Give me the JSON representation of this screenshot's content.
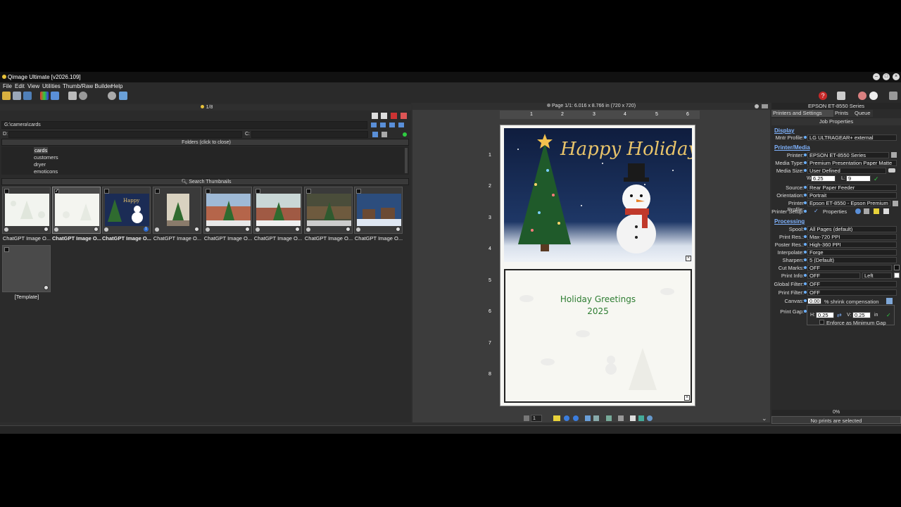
{
  "window": {
    "title": "Qimage Ultimate [v2026.109]"
  },
  "menu": [
    "File",
    "Edit",
    "View",
    "Utilities",
    "Thumb/Raw Builder",
    "Help"
  ],
  "left": {
    "page_indicator": "1/8",
    "path": "G:\\camera\\cards",
    "d_label": "D:",
    "c_label": "C:",
    "folders_header": "Folders (click to close)",
    "folders": [
      "cards",
      "customers",
      "dryer",
      "emoticons"
    ],
    "search_thumbnails": "Search Thumbnails",
    "thumbs": [
      {
        "label": "ChatGPT Image O...",
        "checked": false,
        "bold": false
      },
      {
        "label": "ChatGPT Image O...",
        "checked": true,
        "bold": true
      },
      {
        "label": "ChatGPT Image O...",
        "checked": false,
        "bold": true,
        "badge": "1"
      },
      {
        "label": "ChatGPT Image O...",
        "checked": false,
        "bold": false
      },
      {
        "label": "ChatGPT Image O...",
        "checked": false,
        "bold": false
      },
      {
        "label": "ChatGPT Image O...",
        "checked": false,
        "bold": false
      },
      {
        "label": "ChatGPT Image O...",
        "checked": false,
        "bold": false
      },
      {
        "label": "ChatGPT Image O...",
        "checked": false,
        "bold": false
      }
    ],
    "template_label": "[Template]"
  },
  "mid": {
    "page_info": "Page 1/1: 6.016 x 8.766 in   (720 x 720)",
    "ruler_h": [
      "1",
      "2",
      "3",
      "4",
      "5",
      "6"
    ],
    "ruler_v": [
      "1",
      "2",
      "3",
      "4",
      "5",
      "6",
      "7",
      "8"
    ],
    "card_top_text": "Happy Holidays",
    "card_bottom_line1": "Holiday Greetings",
    "card_bottom_line2": "2025",
    "page_field": "1"
  },
  "right": {
    "printer_title": "EPSON ET-8550 Series",
    "tabs": [
      "Printers and Settings",
      "Prints",
      "Queue"
    ],
    "job_properties": "Job Properties",
    "section_display": "Display",
    "section_printer_media": "Printer/Media",
    "section_processing": "Processing",
    "rows": {
      "mntr_profile": {
        "label": "Mntr Profile:",
        "value": "LG ULTRAGEAR+ external"
      },
      "printer": {
        "label": "Printer:",
        "value": "EPSON ET-8550 Series"
      },
      "media_type": {
        "label": "Media Type:",
        "value": "Premium Presentation Paper Matte"
      },
      "media_size": {
        "label": "Media Size:",
        "value": "User Defined"
      },
      "w_label": "W:",
      "w_value": "6.25",
      "l_label": "L:",
      "l_value": "9",
      "source": {
        "label": "Source:",
        "value": "Rear Paper Feeder"
      },
      "orientation": {
        "label": "Orientation:",
        "value": "Portrait"
      },
      "printer_profile": {
        "label": "Printer Profile:",
        "value": "Epson ET-8550 - Epson Premium"
      },
      "printer_setup": {
        "label": "Printer Setup:",
        "value": "Properties"
      },
      "spool": {
        "label": "Spool:",
        "value": "All Pages (default)"
      },
      "print_res": {
        "label": "Print Res.:",
        "value": "Max-720 PPI"
      },
      "poster_res": {
        "label": "Poster Res.:",
        "value": "High-360 PPI"
      },
      "interpolate": {
        "label": "Interpolate:",
        "value": "Forge"
      },
      "sharpen": {
        "label": "Sharpen:",
        "value": "5 (Default)"
      },
      "cut_marks": {
        "label": "Cut Marks:",
        "value": "OFF"
      },
      "print_info": {
        "label": "Print Info:",
        "value": "OFF",
        "value2": "Left"
      },
      "global_filter": {
        "label": "Global Filter:",
        "value": "OFF"
      },
      "print_filter": {
        "label": "Print Filter:",
        "value": "OFF"
      },
      "canvas": {
        "label": "Canvas:",
        "value": "0.00",
        "suffix": "% shrink compensation"
      },
      "print_gap": {
        "label": "Print Gap:",
        "h_label": "H:",
        "h_value": "0.25",
        "v_label": "V:",
        "v_value": "0.25",
        "unit": "in"
      },
      "enforce": "Enforce as Minimum Gap"
    },
    "progress": "0%",
    "status": "No prints are selected"
  },
  "colors": {
    "accent_blue": "#7fb3ff",
    "card_green": "#2e7d32",
    "card_gold": "#e9c46a"
  }
}
